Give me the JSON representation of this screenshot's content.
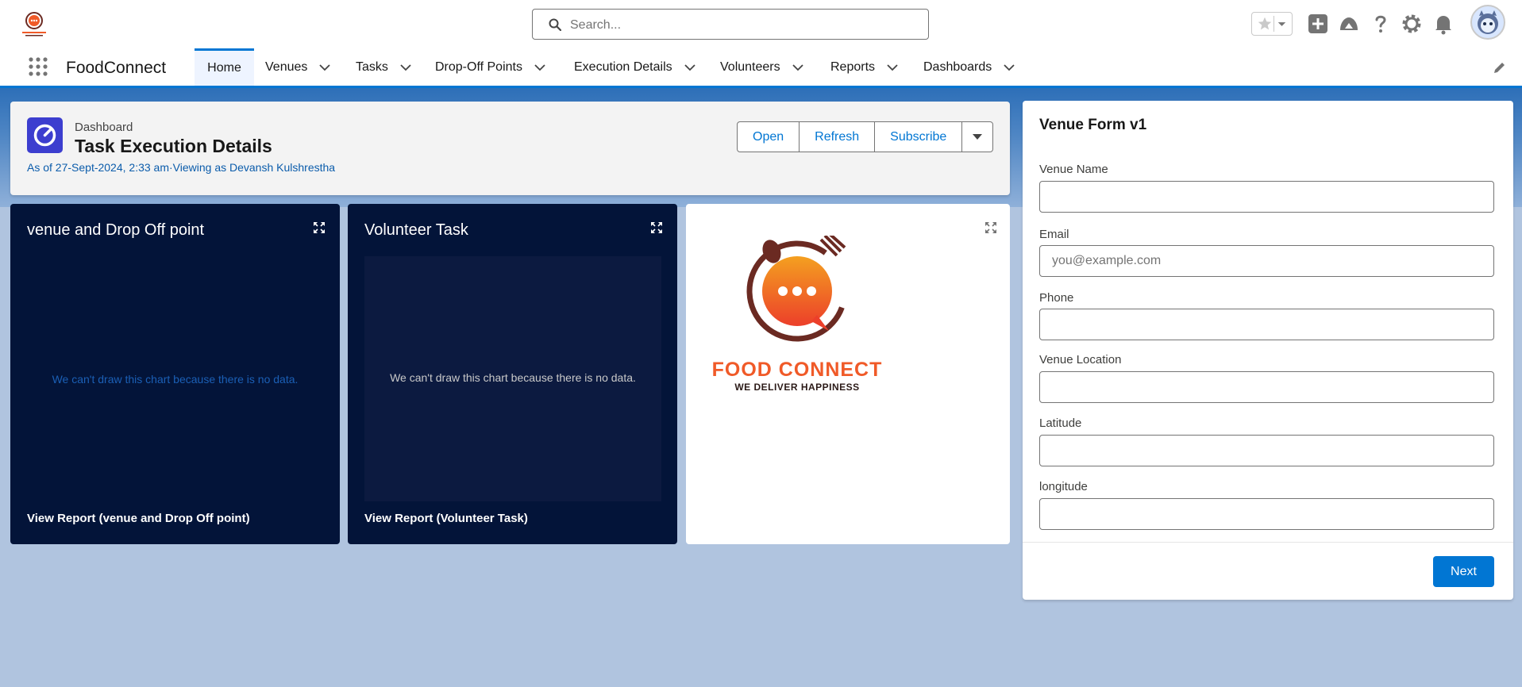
{
  "header": {
    "logo_name": "FoodConnect logo",
    "search_placeholder": "Search...",
    "icons": [
      "favorites-star-icon",
      "add-icon",
      "trailhead-icon",
      "help-icon",
      "setup-gear-icon",
      "notifications-bell-icon",
      "user-avatar"
    ]
  },
  "nav": {
    "app_name": "FoodConnect",
    "items": [
      {
        "label": "Home",
        "active": true
      },
      {
        "label": "Venues"
      },
      {
        "label": "Tasks"
      },
      {
        "label": "Drop-Off Points"
      },
      {
        "label": "Execution Details"
      },
      {
        "label": "Volunteers"
      },
      {
        "label": "Reports"
      },
      {
        "label": "Dashboards"
      }
    ]
  },
  "dashboard": {
    "type_label": "Dashboard",
    "title": "Task Execution Details",
    "subtitle": "As of 27-Sept-2024, 2:33 am·Viewing as Devansh Kulshrestha",
    "buttons": {
      "open": "Open",
      "refresh": "Refresh",
      "subscribe": "Subscribe"
    }
  },
  "widgets": [
    {
      "title": "venue and Drop Off point",
      "no_data": "We can't draw this chart because there is no data.",
      "link": "View Report (venue and Drop Off point)"
    },
    {
      "title": "Volunteer Task",
      "no_data": "We can't draw this chart because there is no data.",
      "link": "View Report (Volunteer Task)"
    }
  ],
  "image_widget": {
    "logo_text": "FOOD CONNECT",
    "tagline": "WE DELIVER HAPPINESS"
  },
  "form": {
    "title": "Venue Form v1",
    "fields": [
      {
        "label": "Venue Name",
        "value": "",
        "placeholder": ""
      },
      {
        "label": "Email",
        "value": "",
        "placeholder": "you@example.com"
      },
      {
        "label": "Phone",
        "value": "",
        "placeholder": ""
      },
      {
        "label": "Venue Location",
        "value": "",
        "placeholder": ""
      },
      {
        "label": "Latitude",
        "value": "",
        "placeholder": ""
      },
      {
        "label": "longitude",
        "value": "",
        "placeholder": ""
      }
    ],
    "next_label": "Next"
  },
  "colors": {
    "brand_blue": "#0176d3",
    "widget_bg": "#031439",
    "page_bg": "#b0c4df",
    "logo_orange": "#f05a28",
    "logo_brown": "#6b2a22"
  }
}
